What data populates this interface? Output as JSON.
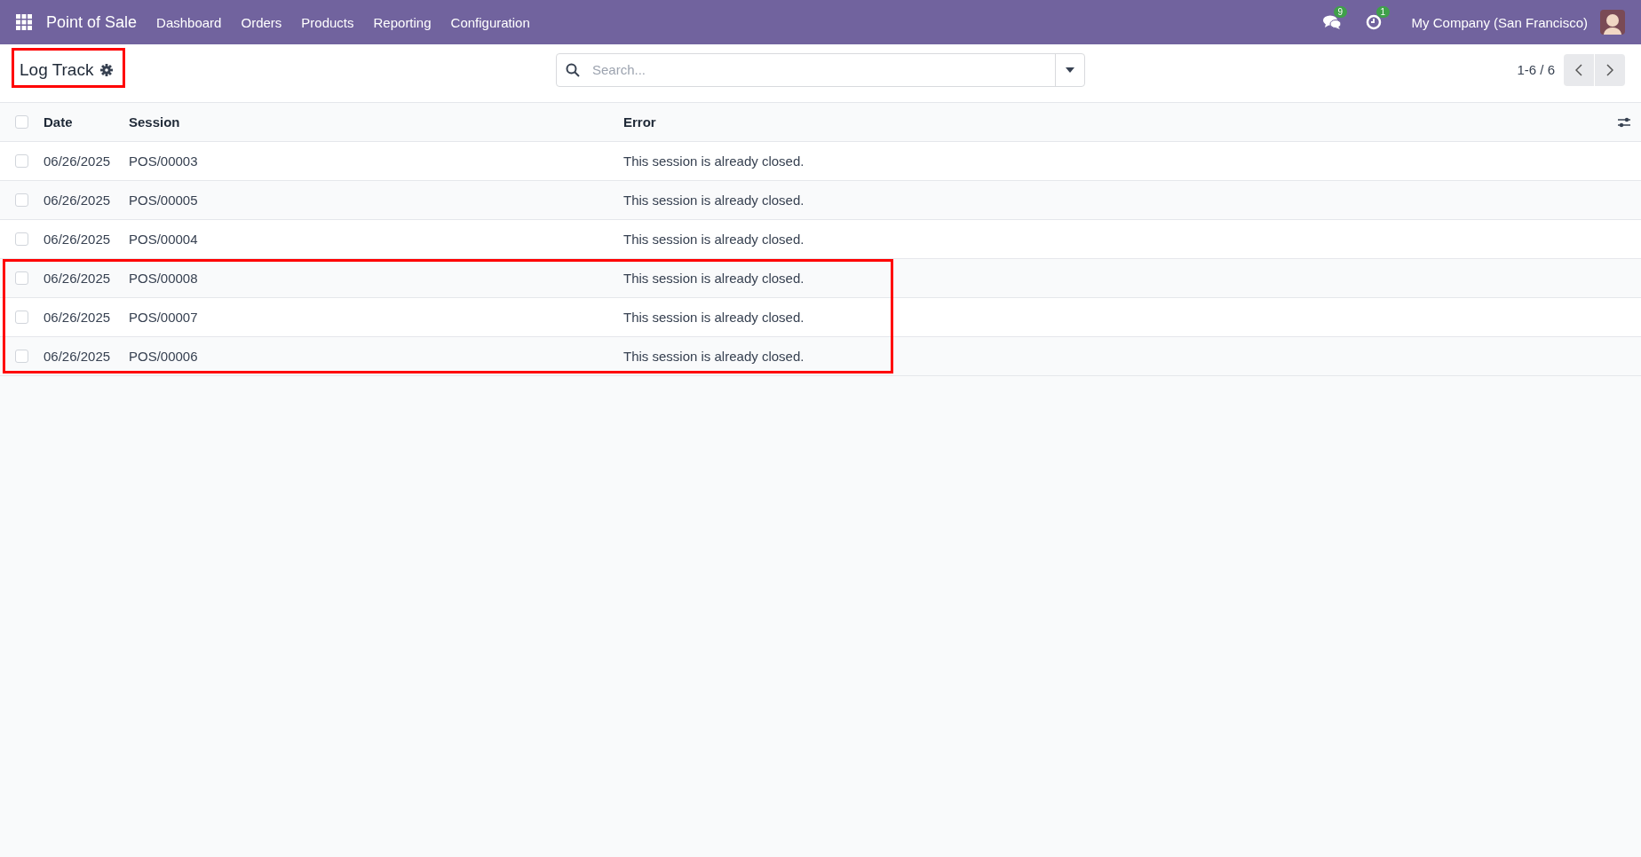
{
  "navbar": {
    "app_name": "Point of Sale",
    "menu": [
      "Dashboard",
      "Orders",
      "Products",
      "Reporting",
      "Configuration"
    ],
    "messages_count": "9",
    "activities_count": "1",
    "company": "My Company (San Francisco)"
  },
  "control_panel": {
    "title": "Log Track",
    "title_highlighted": true,
    "search": {
      "placeholder": "Search..."
    },
    "pager": "1-6 / 6"
  },
  "table": {
    "columns": [
      "Date",
      "Session",
      "Error"
    ],
    "all_checked": false,
    "rows": [
      {
        "date": "06/26/2025",
        "session": "POS/00003",
        "error": "This session is already closed.",
        "checked": false,
        "highlighted": false
      },
      {
        "date": "06/26/2025",
        "session": "POS/00005",
        "error": "This session is already closed.",
        "checked": false,
        "highlighted": false
      },
      {
        "date": "06/26/2025",
        "session": "POS/00004",
        "error": "This session is already closed.",
        "checked": false,
        "highlighted": false
      },
      {
        "date": "06/26/2025",
        "session": "POS/00008",
        "error": "This session is already closed.",
        "checked": false,
        "highlighted": true
      },
      {
        "date": "06/26/2025",
        "session": "POS/00007",
        "error": "This session is already closed.",
        "checked": false,
        "highlighted": true
      },
      {
        "date": "06/26/2025",
        "session": "POS/00006",
        "error": "This session is already closed.",
        "checked": false,
        "highlighted": true
      }
    ]
  }
}
